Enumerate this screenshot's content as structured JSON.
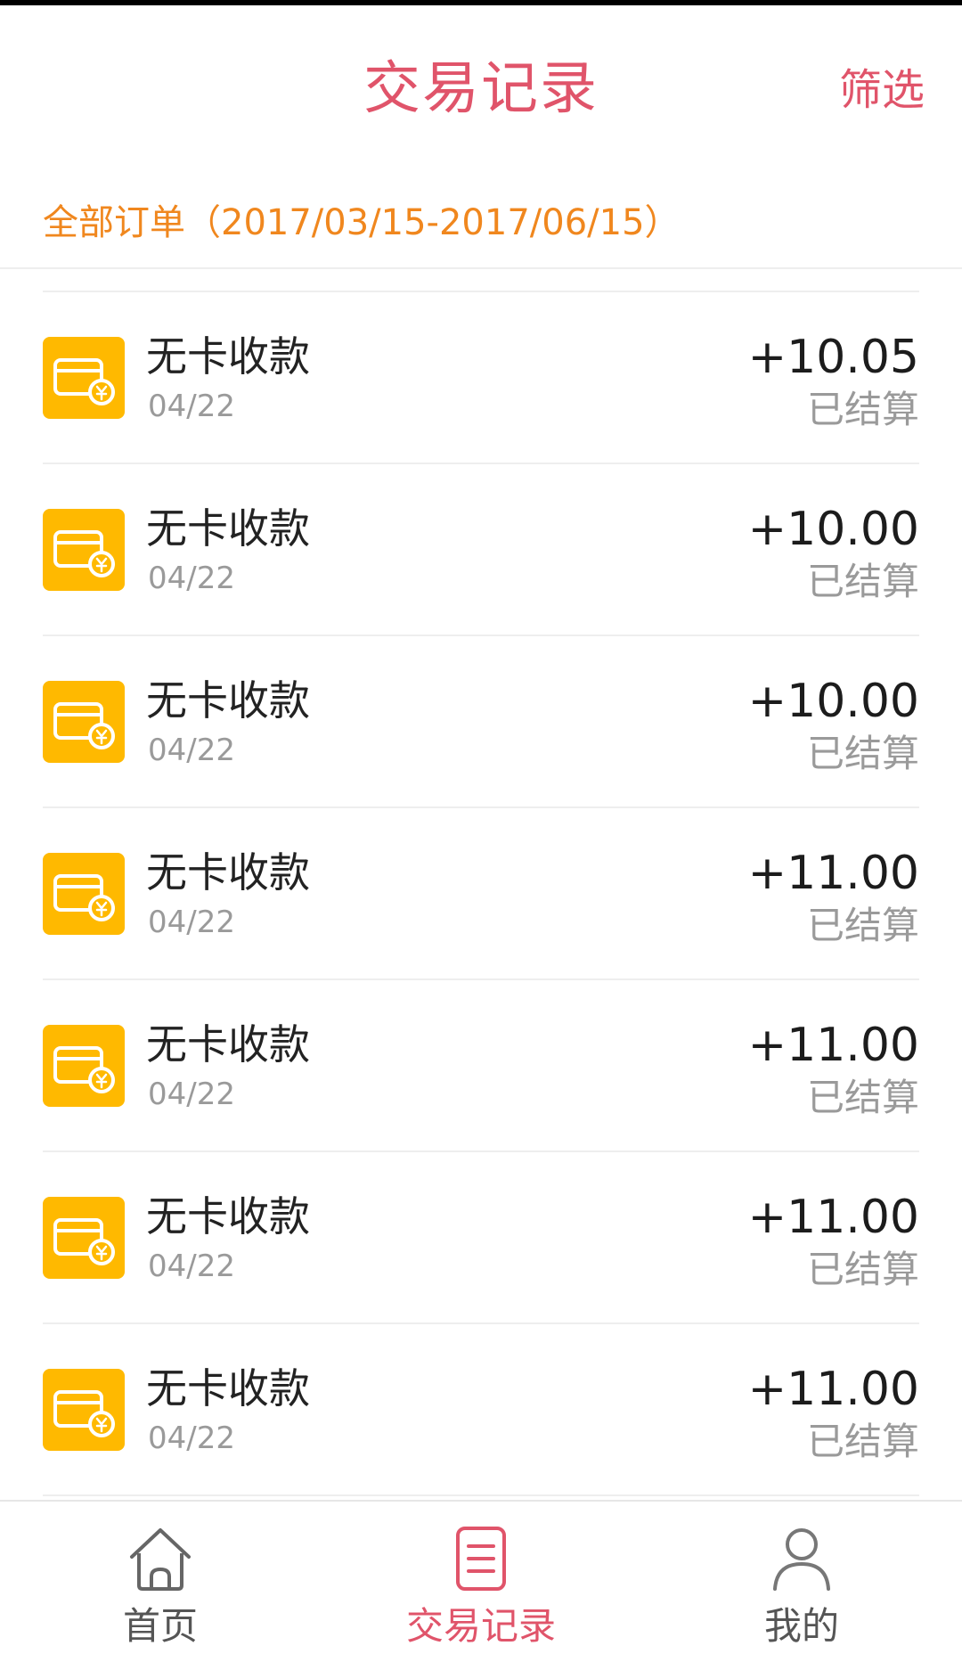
{
  "header": {
    "title": "交易记录",
    "filter_label": "筛选"
  },
  "range": {
    "text": "全部订单（2017/03/15-2017/06/15）"
  },
  "colors": {
    "accent": "#e0546a",
    "range_text": "#f0871e",
    "icon_bg": "#ffb900"
  },
  "transactions": [
    {
      "title": "无卡收款",
      "date": "04/22",
      "amount": "+10.05",
      "status": "已结算",
      "icon": "card-yuan-icon"
    },
    {
      "title": "无卡收款",
      "date": "04/22",
      "amount": "+10.00",
      "status": "已结算",
      "icon": "card-yuan-icon"
    },
    {
      "title": "无卡收款",
      "date": "04/22",
      "amount": "+10.00",
      "status": "已结算",
      "icon": "card-yuan-icon"
    },
    {
      "title": "无卡收款",
      "date": "04/22",
      "amount": "+11.00",
      "status": "已结算",
      "icon": "card-yuan-icon"
    },
    {
      "title": "无卡收款",
      "date": "04/22",
      "amount": "+11.00",
      "status": "已结算",
      "icon": "card-yuan-icon"
    },
    {
      "title": "无卡收款",
      "date": "04/22",
      "amount": "+11.00",
      "status": "已结算",
      "icon": "card-yuan-icon"
    },
    {
      "title": "无卡收款",
      "date": "04/22",
      "amount": "+11.00",
      "status": "已结算",
      "icon": "card-yuan-icon"
    }
  ],
  "tabs": [
    {
      "label": "首页",
      "icon": "home-icon",
      "active": false
    },
    {
      "label": "交易记录",
      "icon": "document-list-icon",
      "active": true
    },
    {
      "label": "我的",
      "icon": "person-icon",
      "active": false
    }
  ]
}
